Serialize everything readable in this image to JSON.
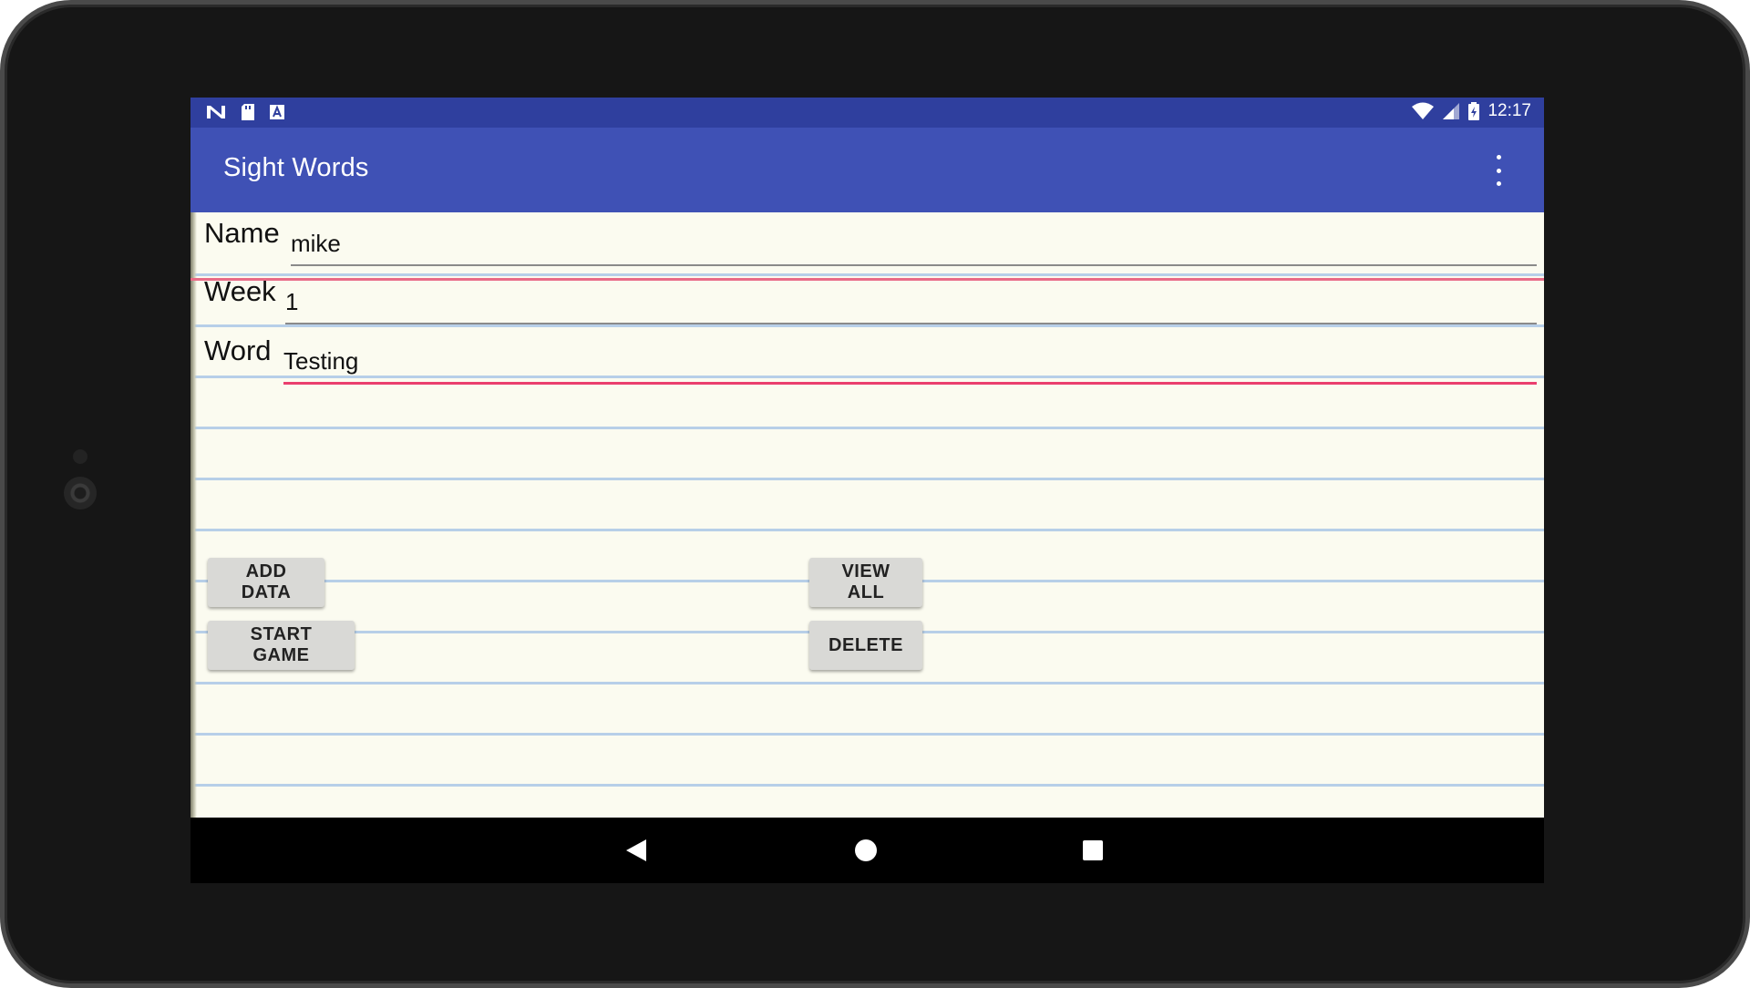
{
  "status_bar": {
    "time": "12:17",
    "left_icons": [
      "notification-n-icon",
      "sd-card-icon",
      "text-icon"
    ],
    "right_icons": [
      "wifi-icon",
      "cell-signal-icon",
      "battery-charging-icon"
    ]
  },
  "app_bar": {
    "title": "Sight Words",
    "overflow_icon": "more-vertical-icon"
  },
  "form": {
    "name_label": "Name",
    "name_value": "mike",
    "week_label": "Week",
    "week_value": "1",
    "word_label": "Word",
    "word_value": "Testing"
  },
  "buttons": {
    "add_data": "ADD DATA",
    "view_all": "VIEW ALL",
    "start_game": "START GAME",
    "delete": "DELETE"
  },
  "nav_bar": {
    "back_icon": "back-triangle-icon",
    "home_icon": "home-circle-icon",
    "recent_icon": "recent-square-icon"
  },
  "colors": {
    "status_bar": "#2f3f9e",
    "app_bar": "#3f51b5",
    "accent": "#ea3f6e",
    "paper": "#fbfbf0",
    "ruled_line": "#b7cfe8"
  }
}
